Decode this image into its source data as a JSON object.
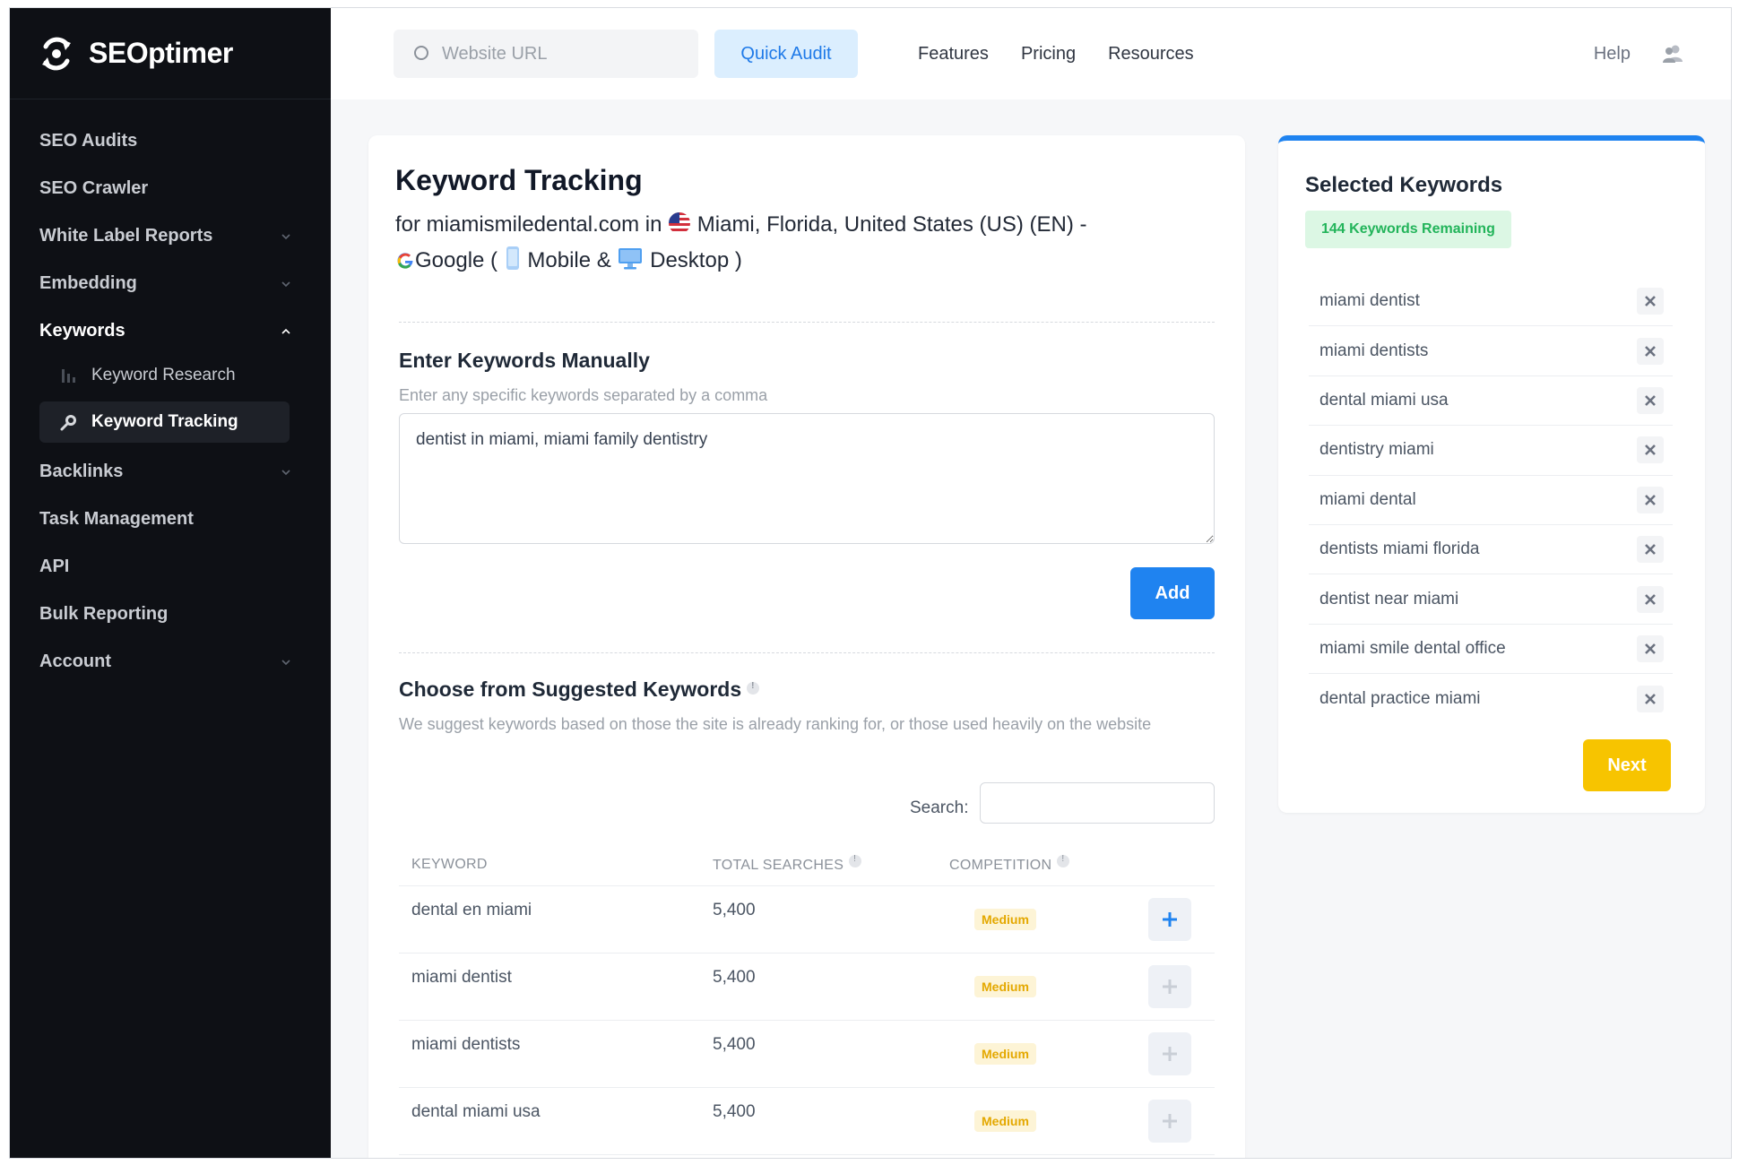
{
  "brand": {
    "name": "SEOptimer"
  },
  "sidebar": {
    "items": [
      {
        "label": "SEO Audits",
        "chevron": false
      },
      {
        "label": "SEO Crawler",
        "chevron": false
      },
      {
        "label": "White Label Reports",
        "chevron": true
      },
      {
        "label": "Embedding",
        "chevron": true
      },
      {
        "label": "Keywords",
        "chevron": true,
        "expanded": true
      },
      {
        "label": "Backlinks",
        "chevron": true
      },
      {
        "label": "Task Management",
        "chevron": false
      },
      {
        "label": "API",
        "chevron": false
      },
      {
        "label": "Bulk Reporting",
        "chevron": false
      },
      {
        "label": "Account",
        "chevron": true
      }
    ],
    "keywords_sub": [
      {
        "label": "Keyword Research",
        "icon": "bar-chart-icon"
      },
      {
        "label": "Keyword Tracking",
        "icon": "magnifier-icon",
        "selected": true
      }
    ]
  },
  "topbar": {
    "url_placeholder": "Website URL",
    "quick_audit": "Quick Audit",
    "links": [
      "Features",
      "Pricing",
      "Resources"
    ],
    "help": "Help"
  },
  "main": {
    "title": "Keyword Tracking",
    "subtitle": {
      "prefix": "for miamismiledental.com in",
      "location": "Miami, Florida, United States (US) (EN) -",
      "engine": "Google (",
      "mobile": "Mobile &",
      "desktop": "Desktop )"
    },
    "manual": {
      "title": "Enter Keywords Manually",
      "desc": "Enter any specific keywords separated by a comma",
      "value": "dentist in miami, miami family dentistry",
      "add": "Add"
    },
    "suggested": {
      "title": "Choose from Suggested Keywords",
      "desc": "We suggest keywords based on those the site is already ranking for, or those used heavily on the website",
      "search_label": "Search:",
      "columns": [
        "KEYWORD",
        "TOTAL SEARCHES",
        "COMPETITION"
      ],
      "rows": [
        {
          "keyword": "dental en miami",
          "searches": "5,400",
          "competition": "Medium",
          "active": true
        },
        {
          "keyword": "miami dentist",
          "searches": "5,400",
          "competition": "Medium",
          "active": false
        },
        {
          "keyword": "miami dentists",
          "searches": "5,400",
          "competition": "Medium",
          "active": false
        },
        {
          "keyword": "dental miami usa",
          "searches": "5,400",
          "competition": "Medium",
          "active": false
        }
      ]
    }
  },
  "selected": {
    "title": "Selected Keywords",
    "remaining": "144 Keywords Remaining",
    "keywords": [
      "miami dentist",
      "miami dentists",
      "dental miami usa",
      "dentistry miami",
      "miami dental",
      "dentists miami florida",
      "dentist near miami",
      "miami smile dental office",
      "dental practice miami"
    ],
    "next": "Next"
  },
  "colors": {
    "accent": "#1f83f0",
    "next": "#f7c400",
    "sidebar": "#0e1015"
  }
}
